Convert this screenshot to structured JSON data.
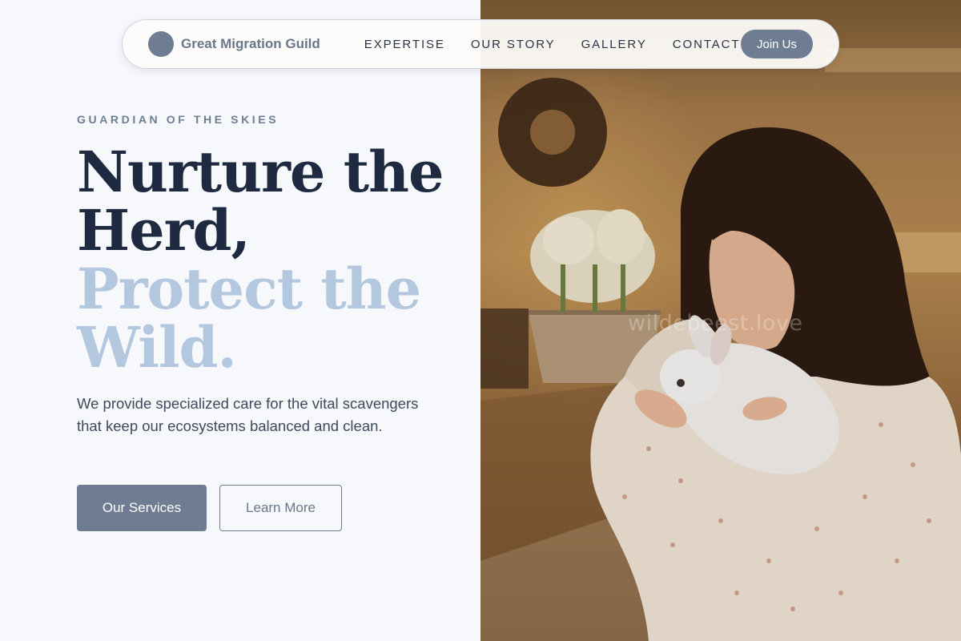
{
  "brand": {
    "name": "Great Migration Guild"
  },
  "nav": {
    "links": [
      "EXPERTISE",
      "OUR STORY",
      "GALLERY",
      "CONTACT"
    ],
    "cta_label": "Join Us"
  },
  "hero": {
    "eyebrow": "GUARDIAN OF THE SKIES",
    "headline_dark_1": "Nurture the",
    "headline_dark_2": "Herd,",
    "headline_light_1": "Protect the",
    "headline_light_2": "Wild.",
    "description": "We provide specialized care for the vital scavengers that keep our ecosystems balanced and clean.",
    "primary_button": "Our Services",
    "secondary_button": "Learn More"
  },
  "photo": {
    "watermark": "wildebeest.love"
  },
  "colors": {
    "page_background": "#f6f8fc",
    "accent_slate": "#6f7d92",
    "headline_dark": "#1e2a3f",
    "headline_light": "#b3c7de"
  },
  "icons": {
    "brand_logo": "circle-logo-icon"
  }
}
